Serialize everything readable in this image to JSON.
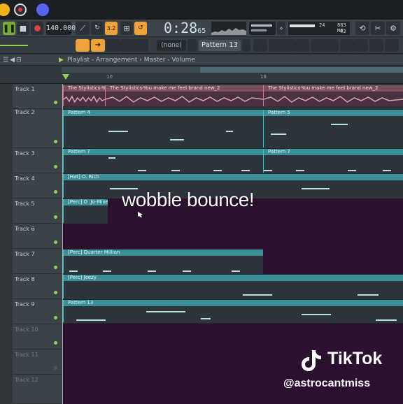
{
  "transport": {
    "tempo": "140.000",
    "time_main": "0:28",
    "time_sub": "65",
    "mem_mb": "883 MB",
    "cpu": "24",
    "poly": "43"
  },
  "toolbar2": {
    "snap": "(none)",
    "pattern": "Pattern 13"
  },
  "playlist": {
    "title": "Playlist - Arrangement",
    "path": "Master - Volume",
    "ruler_marks": [
      "10",
      "18"
    ]
  },
  "tracks": [
    {
      "name": "Track 1"
    },
    {
      "name": "Track 2"
    },
    {
      "name": "Track 3"
    },
    {
      "name": "Track 4"
    },
    {
      "name": "Track 5"
    },
    {
      "name": "Track 6"
    },
    {
      "name": "Track 7"
    },
    {
      "name": "Track 8"
    },
    {
      "name": "Track 9"
    },
    {
      "name": "Track 10"
    },
    {
      "name": "Track 11"
    },
    {
      "name": "Track 12"
    }
  ],
  "clips": {
    "audio_a": "The Stylistics-You make me feel brand new_2",
    "audio_b": "The Stylistics-You make me feel brand new_2",
    "audio_c": "The Stylistics-You make me feel brand new_2",
    "p4": "Pattern 4",
    "p5": "Pattern 5",
    "p7a": "Pattern 7",
    "p7b": "Pattern 7",
    "hat": "[Hat] O. Rich",
    "perc1": "[Perc] O .Jo-Mixed",
    "perc2": "[Perc] Quarter Million",
    "perc3": "[Perc] Jeezy",
    "p13": "Pattern 13"
  },
  "overlay": {
    "caption": "wobble bounce!",
    "brand": "TikTok",
    "handle": "@astrocantmiss"
  },
  "colors": {
    "clip_teal": "#3a8f99",
    "audio_pink": "#7a4e5d",
    "empty_lane": "#2c1030",
    "accent_orange": "#f0a23a"
  }
}
